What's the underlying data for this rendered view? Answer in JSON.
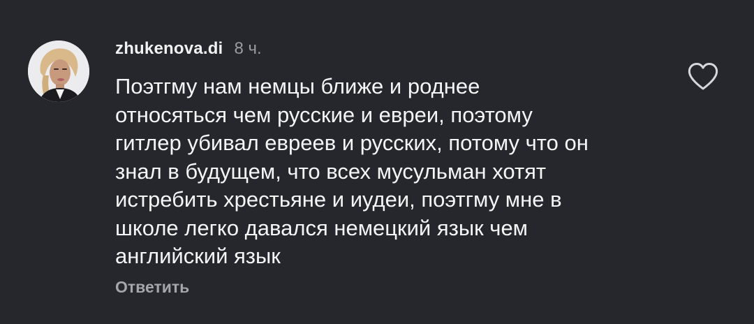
{
  "comment": {
    "avatar_icon": "profile-photo-icon",
    "username": "zhukenova.di",
    "timestamp": "8 ч.",
    "text_lines": [
      "Поэтгму нам немцы ближе и роднее",
      "относяться чем русские и евреи, поэтому",
      "гитлер убивал евреев и русских, потому что он",
      "знал в будущем, что всех мусульман хотят",
      "истребить хрестьяне и иудеи, поэтгму мне в",
      "школе легко давался немецкий язык чем",
      "английский язык"
    ],
    "reply_label": "Ответить",
    "like_icon": "heart-outline-icon"
  },
  "colors": {
    "background": "#25272d",
    "text": "#f5f5f5",
    "muted": "#9a9ca2"
  }
}
